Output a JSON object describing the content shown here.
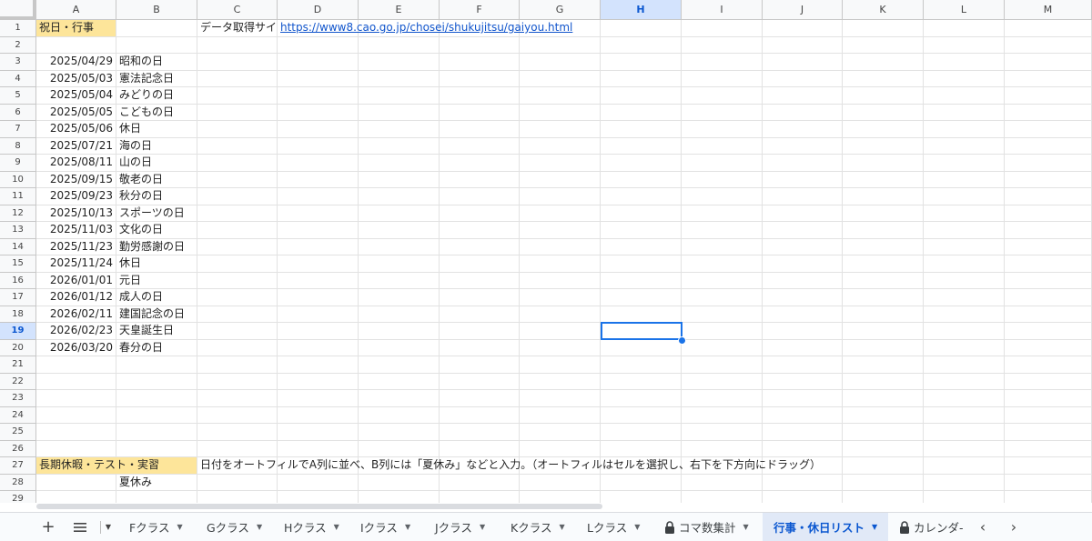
{
  "columns": [
    "A",
    "B",
    "C",
    "D",
    "E",
    "F",
    "G",
    "H",
    "I",
    "J",
    "K",
    "L",
    "M"
  ],
  "selected_column": "H",
  "selected_row": 19,
  "rows": [
    1,
    2,
    3,
    4,
    5,
    6,
    7,
    8,
    9,
    10,
    11,
    12,
    13,
    14,
    15,
    16,
    17,
    18,
    19,
    20,
    21,
    22,
    23,
    24,
    25,
    26,
    27,
    28,
    29
  ],
  "header": {
    "title": "祝日・行事",
    "source_label": "データ取得サイ",
    "source_url": "https://www8.cao.go.jp/chosei/shukujitsu/gaiyou.html"
  },
  "holidays": [
    {
      "date": "2025/04/29",
      "name": "昭和の日"
    },
    {
      "date": "2025/05/03",
      "name": "憲法記念日"
    },
    {
      "date": "2025/05/04",
      "name": "みどりの日"
    },
    {
      "date": "2025/05/05",
      "name": "こどもの日"
    },
    {
      "date": "2025/05/06",
      "name": "休日"
    },
    {
      "date": "2025/07/21",
      "name": "海の日"
    },
    {
      "date": "2025/08/11",
      "name": "山の日"
    },
    {
      "date": "2025/09/15",
      "name": "敬老の日"
    },
    {
      "date": "2025/09/23",
      "name": "秋分の日"
    },
    {
      "date": "2025/10/13",
      "name": "スポーツの日"
    },
    {
      "date": "2025/11/03",
      "name": "文化の日"
    },
    {
      "date": "2025/11/23",
      "name": "勤労感謝の日"
    },
    {
      "date": "2025/11/24",
      "name": "休日"
    },
    {
      "date": "2026/01/01",
      "name": "元日"
    },
    {
      "date": "2026/01/12",
      "name": "成人の日"
    },
    {
      "date": "2026/02/11",
      "name": "建国記念の日"
    },
    {
      "date": "2026/02/23",
      "name": "天皇誕生日"
    },
    {
      "date": "2026/03/20",
      "name": "春分の日"
    }
  ],
  "section2": {
    "title": "長期休暇・テスト・実習",
    "instruction": "日付をオートフィルでA列に並べ、B列には「夏休み」などと入力。（オートフィルはセルを選択し、右下を下方向にドラッグ）",
    "first_item": "夏休み"
  },
  "tabs": [
    {
      "label": "Fクラス",
      "locked": false,
      "active": false
    },
    {
      "label": "Gクラス",
      "locked": false,
      "active": false
    },
    {
      "label": "Hクラス",
      "locked": false,
      "active": false
    },
    {
      "label": "Iクラス",
      "locked": false,
      "active": false
    },
    {
      "label": "Jクラス",
      "locked": false,
      "active": false
    },
    {
      "label": "Kクラス",
      "locked": false,
      "active": false
    },
    {
      "label": "Lクラス",
      "locked": false,
      "active": false
    },
    {
      "label": "コマ数集計",
      "locked": true,
      "active": false
    },
    {
      "label": "行事・休日リスト",
      "locked": false,
      "active": true
    },
    {
      "label": "カレンダ-",
      "locked": true,
      "active": false
    }
  ],
  "colors": {
    "accent": "#1a73e8",
    "highlight": "#fde59a",
    "link": "#1155cc"
  }
}
